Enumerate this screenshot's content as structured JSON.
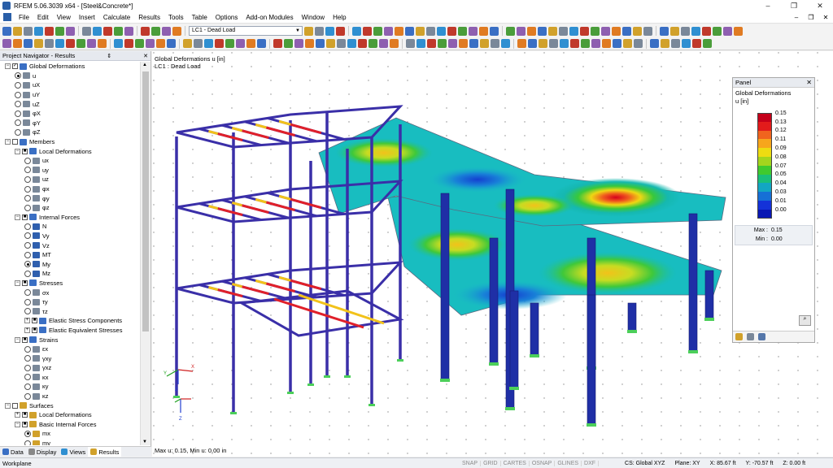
{
  "window": {
    "title": "RFEM 5.06.3039 x64 - [Steel&Concrete*]",
    "controls": [
      "–",
      "❐",
      "✕"
    ]
  },
  "menu": [
    "File",
    "Edit",
    "View",
    "Insert",
    "Calculate",
    "Results",
    "Tools",
    "Table",
    "Options",
    "Add-on Modules",
    "Window",
    "Help"
  ],
  "load_case": "LC1 - Dead Load",
  "navigator": {
    "title": "Project Navigator - Results",
    "rows": [
      {
        "lvl": 0,
        "tw": "−",
        "cb": "✓",
        "ico": "#3a6fc4",
        "label": "Global Deformations"
      },
      {
        "lvl": 1,
        "rb": true,
        "ico": "#7a8899",
        "label": "u"
      },
      {
        "lvl": 1,
        "rb": false,
        "ico": "#7a8899",
        "label": "uX"
      },
      {
        "lvl": 1,
        "rb": false,
        "ico": "#7a8899",
        "label": "uY"
      },
      {
        "lvl": 1,
        "rb": false,
        "ico": "#7a8899",
        "label": "uZ"
      },
      {
        "lvl": 1,
        "rb": false,
        "ico": "#7a8899",
        "label": "φX"
      },
      {
        "lvl": 1,
        "rb": false,
        "ico": "#7a8899",
        "label": "φY"
      },
      {
        "lvl": 1,
        "rb": false,
        "ico": "#7a8899",
        "label": "φZ"
      },
      {
        "lvl": 0,
        "tw": "−",
        "cb": "",
        "ico": "#3a6fc4",
        "label": "Members"
      },
      {
        "lvl": 1,
        "tw": "−",
        "cb": "■",
        "ico": "#3a6fc4",
        "label": "Local Deformations"
      },
      {
        "lvl": 2,
        "rb": false,
        "ico": "#7a8899",
        "label": "ux"
      },
      {
        "lvl": 2,
        "rb": false,
        "ico": "#7a8899",
        "label": "uy"
      },
      {
        "lvl": 2,
        "rb": false,
        "ico": "#7a8899",
        "label": "uz"
      },
      {
        "lvl": 2,
        "rb": false,
        "ico": "#7a8899",
        "label": "φx"
      },
      {
        "lvl": 2,
        "rb": false,
        "ico": "#7a8899",
        "label": "φy"
      },
      {
        "lvl": 2,
        "rb": false,
        "ico": "#7a8899",
        "label": "φz"
      },
      {
        "lvl": 1,
        "tw": "−",
        "cb": "■",
        "ico": "#3a6fc4",
        "label": "Internal Forces"
      },
      {
        "lvl": 2,
        "rb": false,
        "ico": "#2f5fae",
        "label": "N"
      },
      {
        "lvl": 2,
        "rb": false,
        "ico": "#2f5fae",
        "label": "Vy"
      },
      {
        "lvl": 2,
        "rb": false,
        "ico": "#2f5fae",
        "label": "Vz"
      },
      {
        "lvl": 2,
        "rb": false,
        "ico": "#2f5fae",
        "label": "MT"
      },
      {
        "lvl": 2,
        "rb": true,
        "ico": "#2f5fae",
        "label": "My"
      },
      {
        "lvl": 2,
        "rb": false,
        "ico": "#2f5fae",
        "label": "Mz"
      },
      {
        "lvl": 1,
        "tw": "−",
        "cb": "■",
        "ico": "#3a6fc4",
        "label": "Stresses"
      },
      {
        "lvl": 2,
        "rb": false,
        "ico": "#7a8899",
        "label": "σx"
      },
      {
        "lvl": 2,
        "rb": false,
        "ico": "#7a8899",
        "label": "τy"
      },
      {
        "lvl": 2,
        "rb": false,
        "ico": "#7a8899",
        "label": "τz"
      },
      {
        "lvl": 2,
        "tw": "+",
        "cb": "■",
        "ico": "#3a6fc4",
        "label": "Elastic Stress Components"
      },
      {
        "lvl": 2,
        "tw": "+",
        "cb": "■",
        "ico": "#3a6fc4",
        "label": "Elastic Equivalent Stresses"
      },
      {
        "lvl": 1,
        "tw": "−",
        "cb": "■",
        "ico": "#3a6fc4",
        "label": "Strains"
      },
      {
        "lvl": 2,
        "rb": false,
        "ico": "#7a8899",
        "label": "εx"
      },
      {
        "lvl": 2,
        "rb": false,
        "ico": "#7a8899",
        "label": "γxy"
      },
      {
        "lvl": 2,
        "rb": false,
        "ico": "#7a8899",
        "label": "γxz"
      },
      {
        "lvl": 2,
        "rb": false,
        "ico": "#7a8899",
        "label": "κx"
      },
      {
        "lvl": 2,
        "rb": false,
        "ico": "#7a8899",
        "label": "κy"
      },
      {
        "lvl": 2,
        "rb": false,
        "ico": "#7a8899",
        "label": "κz"
      },
      {
        "lvl": 0,
        "tw": "−",
        "cb": "",
        "ico": "#d1a12b",
        "label": "Surfaces"
      },
      {
        "lvl": 1,
        "tw": "+",
        "cb": "■",
        "ico": "#d1a12b",
        "label": "Local Deformations"
      },
      {
        "lvl": 1,
        "tw": "−",
        "cb": "■",
        "ico": "#d1a12b",
        "label": "Basic Internal Forces"
      },
      {
        "lvl": 2,
        "rb": true,
        "ico": "#d1a12b",
        "label": "mx"
      },
      {
        "lvl": 2,
        "rb": false,
        "ico": "#d1a12b",
        "label": "my"
      }
    ],
    "tabs": [
      {
        "label": "Data",
        "color": "#3a6fc4",
        "active": false
      },
      {
        "label": "Display",
        "color": "#888888",
        "active": false
      },
      {
        "label": "Views",
        "color": "#2f8fd1",
        "active": false
      },
      {
        "label": "Results",
        "color": "#d1a12b",
        "active": true
      }
    ]
  },
  "viewport": {
    "info_line1": "Global Deformations u [in]",
    "info_line2": "LC1 : Dead Load",
    "bottom_text": "Max u: 0.15, Min u: 0.00 in",
    "axes": {
      "x": "X",
      "y": "Y",
      "z": "Z",
      "z_small": "Z"
    }
  },
  "panel": {
    "title": "Panel",
    "result_title": "Global Deformations",
    "result_unit": "u [in]",
    "legend": [
      {
        "value": "0.15",
        "color": "#c4001a"
      },
      {
        "value": "0.13",
        "color": "#e21b1b"
      },
      {
        "value": "0.12",
        "color": "#f0641e"
      },
      {
        "value": "0.11",
        "color": "#f7a61c"
      },
      {
        "value": "0.09",
        "color": "#eedc11"
      },
      {
        "value": "0.08",
        "color": "#a4d51d"
      },
      {
        "value": "0.07",
        "color": "#3fca2e"
      },
      {
        "value": "0.05",
        "color": "#19bf7a"
      },
      {
        "value": "0.04",
        "color": "#12a6c3"
      },
      {
        "value": "0.03",
        "color": "#1670d6"
      },
      {
        "value": "0.01",
        "color": "#1432d8"
      },
      {
        "value": "0.00",
        "color": "#0a18b4"
      }
    ],
    "max_label": "Max :",
    "max_value": "0.15",
    "min_label": "Min :",
    "min_value": "0.00"
  },
  "status": {
    "workplane": "Workplane",
    "buttons": [
      "SNAP",
      "GRID",
      "CARTES",
      "OSNAP",
      "GLINES",
      "DXF"
    ],
    "cs": "CS: Global XYZ",
    "plane": "Plane: XY",
    "x": "X:  85.67 ft",
    "y": "Y:  -70.57 ft",
    "z": "Z:  0.00 ft"
  }
}
